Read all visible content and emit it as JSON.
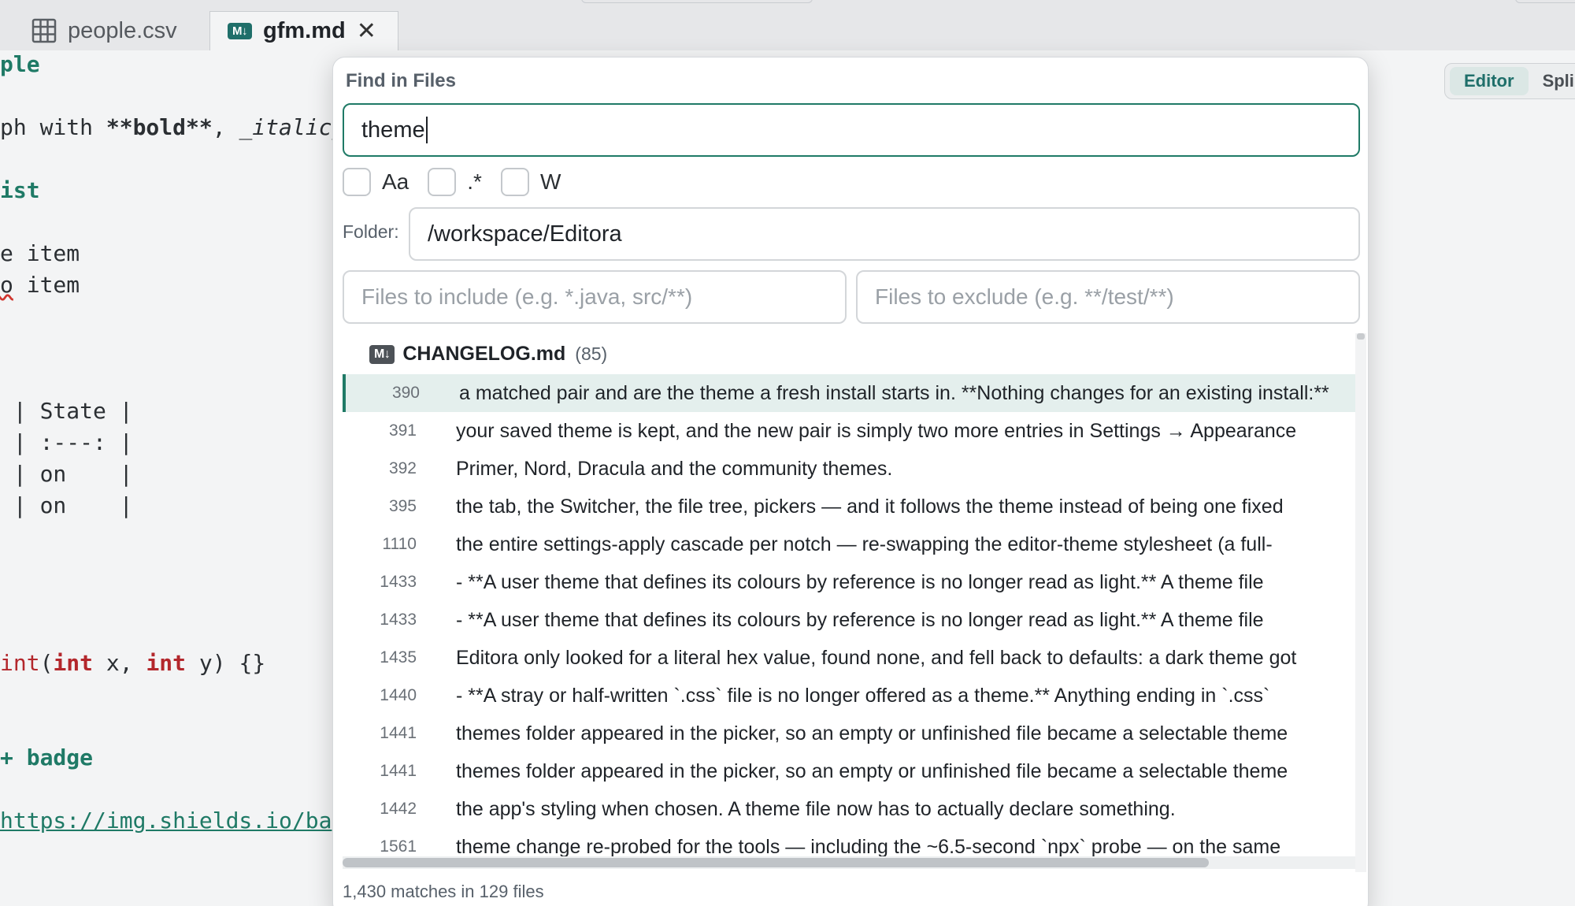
{
  "tabs": [
    {
      "label": "people.csv",
      "icon": "table-icon",
      "active": false
    },
    {
      "label": "gfm.md",
      "icon": "markdown-icon",
      "badge": "M↓",
      "close": "✕",
      "active": true
    }
  ],
  "editor_lines": [
    {
      "kind": "hdr",
      "text": "ple"
    },
    {
      "kind": "para",
      "pre": "ph with ",
      "bold": "**bold**",
      "mid": ", ",
      "ital": "_italic_"
    },
    {
      "kind": "hdr",
      "text": "ist"
    },
    {
      "kind": "plain",
      "text": "e item"
    },
    {
      "kind": "squig",
      "first": "o",
      "text": " item"
    },
    {
      "kind": "plain",
      "text": " | State |"
    },
    {
      "kind": "plain",
      "text": " | :---: |"
    },
    {
      "kind": "plain",
      "text": " | on    |"
    },
    {
      "kind": "plain",
      "text": " | on    |"
    },
    {
      "kind": "code",
      "a": "int",
      "b": "(",
      "c": "int",
      "d": " x, ",
      "e": "int",
      "f": " y) {}"
    },
    {
      "kind": "hdr",
      "text": "+ badge"
    },
    {
      "kind": "link",
      "text": "https://img.shields.io/ba"
    }
  ],
  "mode_switch": {
    "editor": "Editor",
    "split": "Spli"
  },
  "dialog": {
    "title": "Find in Files",
    "query": "theme",
    "options": [
      {
        "label": "Aa",
        "checked": false
      },
      {
        "label": ".*",
        "checked": false
      },
      {
        "label": "W",
        "checked": false
      }
    ],
    "folder_label": "Folder:",
    "folder_value": "/workspace/Editora",
    "include_placeholder": "Files to include (e.g. *.java, src/**)",
    "exclude_placeholder": "Files to exclude (e.g. **/test/**)",
    "file": {
      "badge": "M↓",
      "name": "CHANGELOG.md",
      "count": "(85)"
    },
    "results": [
      {
        "line": "390",
        "text": "a matched pair and are the theme a fresh install starts in. **Nothing changes for an existing install:**",
        "selected": true
      },
      {
        "line": "391",
        "text": "your saved theme is kept, and the new pair is simply two more entries in Settings → Appearance",
        "selected": false
      },
      {
        "line": "392",
        "text": "Primer, Nord, Dracula and the community themes.",
        "selected": false
      },
      {
        "line": "395",
        "text": "the tab, the Switcher, the file tree, pickers — and it follows the theme instead of being one fixed",
        "selected": false
      },
      {
        "line": "1110",
        "text": "the entire settings-apply cascade per notch — re-swapping the editor-theme stylesheet (a full-",
        "selected": false
      },
      {
        "line": "1433",
        "text": "- **A user theme that defines its colours by reference is no longer read as light.** A theme file",
        "selected": false
      },
      {
        "line": "1433",
        "text": "- **A user theme that defines its colours by reference is no longer read as light.** A theme file",
        "selected": false
      },
      {
        "line": "1435",
        "text": "Editora only looked for a literal hex value, found none, and fell back to defaults: a dark theme got",
        "selected": false
      },
      {
        "line": "1440",
        "text": "- **A stray or half-written `.css` file is no longer offered as a theme.** Anything ending in `.css`",
        "selected": false
      },
      {
        "line": "1441",
        "text": "themes folder appeared in the picker, so an empty or unfinished file became a selectable theme",
        "selected": false
      },
      {
        "line": "1441",
        "text": "themes folder appeared in the picker, so an empty or unfinished file became a selectable theme",
        "selected": false
      },
      {
        "line": "1442",
        "text": "the app's styling when chosen. A theme file now has to actually declare something.",
        "selected": false
      },
      {
        "line": "1561",
        "text": "theme change re-probed for the tools — including the ~6.5-second `npx` probe — on the same",
        "selected": false
      }
    ],
    "status": "1,430 matches in 129 files"
  },
  "colors": {
    "accent": "#1f7a66",
    "keyword": "#b3272c",
    "selected_row": "#e4efed"
  }
}
